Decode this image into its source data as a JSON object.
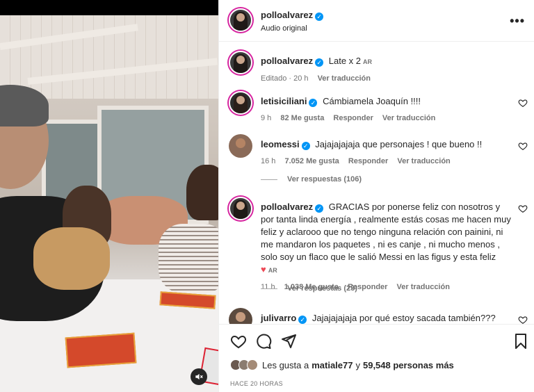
{
  "post": {
    "author": "polloalvarez",
    "audio": "Audio original",
    "caption_author": "polloalvarez",
    "caption_text": "Late x 2",
    "caption_tag": "AR",
    "caption_edited": "Editado · 20 h",
    "caption_translate": "Ver traducción"
  },
  "comments": [
    {
      "user": "letisiciliani",
      "text": "Cámbiamela Joaquín !!!!",
      "time": "9 h",
      "likes": "82 Me gusta",
      "reply": "Responder",
      "translate": "Ver traducción"
    },
    {
      "user": "leomessi",
      "text": "Jajajajajaja que personajes ! que bueno !!",
      "time": "16 h",
      "likes": "7.052 Me gusta",
      "reply": "Responder",
      "translate": "Ver traducción",
      "replies": "Ver respuestas (106)"
    },
    {
      "user": "polloalvarez",
      "text": "GRACIAS por ponerse feliz con nosotros y por tanta linda energía , realmente estás cosas me hacen muy feliz y aclarooo que no tengo ninguna relación con painini, ni me mandaron los paquetes , ni es canje , ni mucho menos , solo soy un flaco que le salió Messi en las figus y esta feliz",
      "tag": "AR",
      "time": "11 h",
      "likes": "1.038 Me gusta",
      "reply": "Responder",
      "translate": "Ver traducción",
      "replies": "Ver respuestas (23)"
    },
    {
      "user": "julivarro",
      "text": "Jajajajajaja por qué estoy sacada también???"
    }
  ],
  "likes_summary": {
    "prefix": "Les gusta a",
    "user": "matiale77",
    "middle": "y",
    "count": "59,548 personas más"
  },
  "date": "HACE 20 HORAS",
  "icons": [
    "mute-icon",
    "more-icon",
    "verified-icon",
    "heart-icon",
    "comment-icon",
    "share-icon",
    "bookmark-icon"
  ],
  "colors": {
    "accent": "#0095f6",
    "heart_red": "#ed4956",
    "muted_text": "#737373"
  }
}
